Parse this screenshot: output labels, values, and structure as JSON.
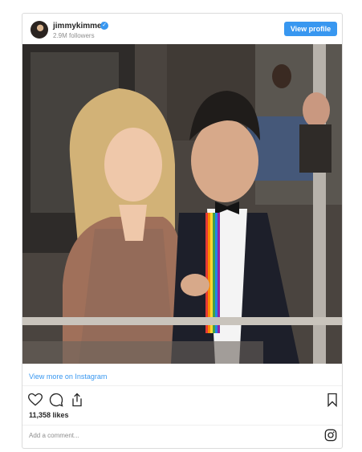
{
  "post": {
    "username": "jimmykimmel",
    "followers": "2.9M followers",
    "view_profile_label": "View profile",
    "view_more_label": "View more on Instagram",
    "likes": "11,358 likes",
    "comment_placeholder": "Add a comment...",
    "verified_icon": "verified-badge-icon",
    "brand_color": "#3897f0"
  },
  "actions": {
    "like_icon": "heart-icon",
    "comment_icon": "comment-icon",
    "share_icon": "share-icon",
    "save_icon": "bookmark-icon"
  }
}
